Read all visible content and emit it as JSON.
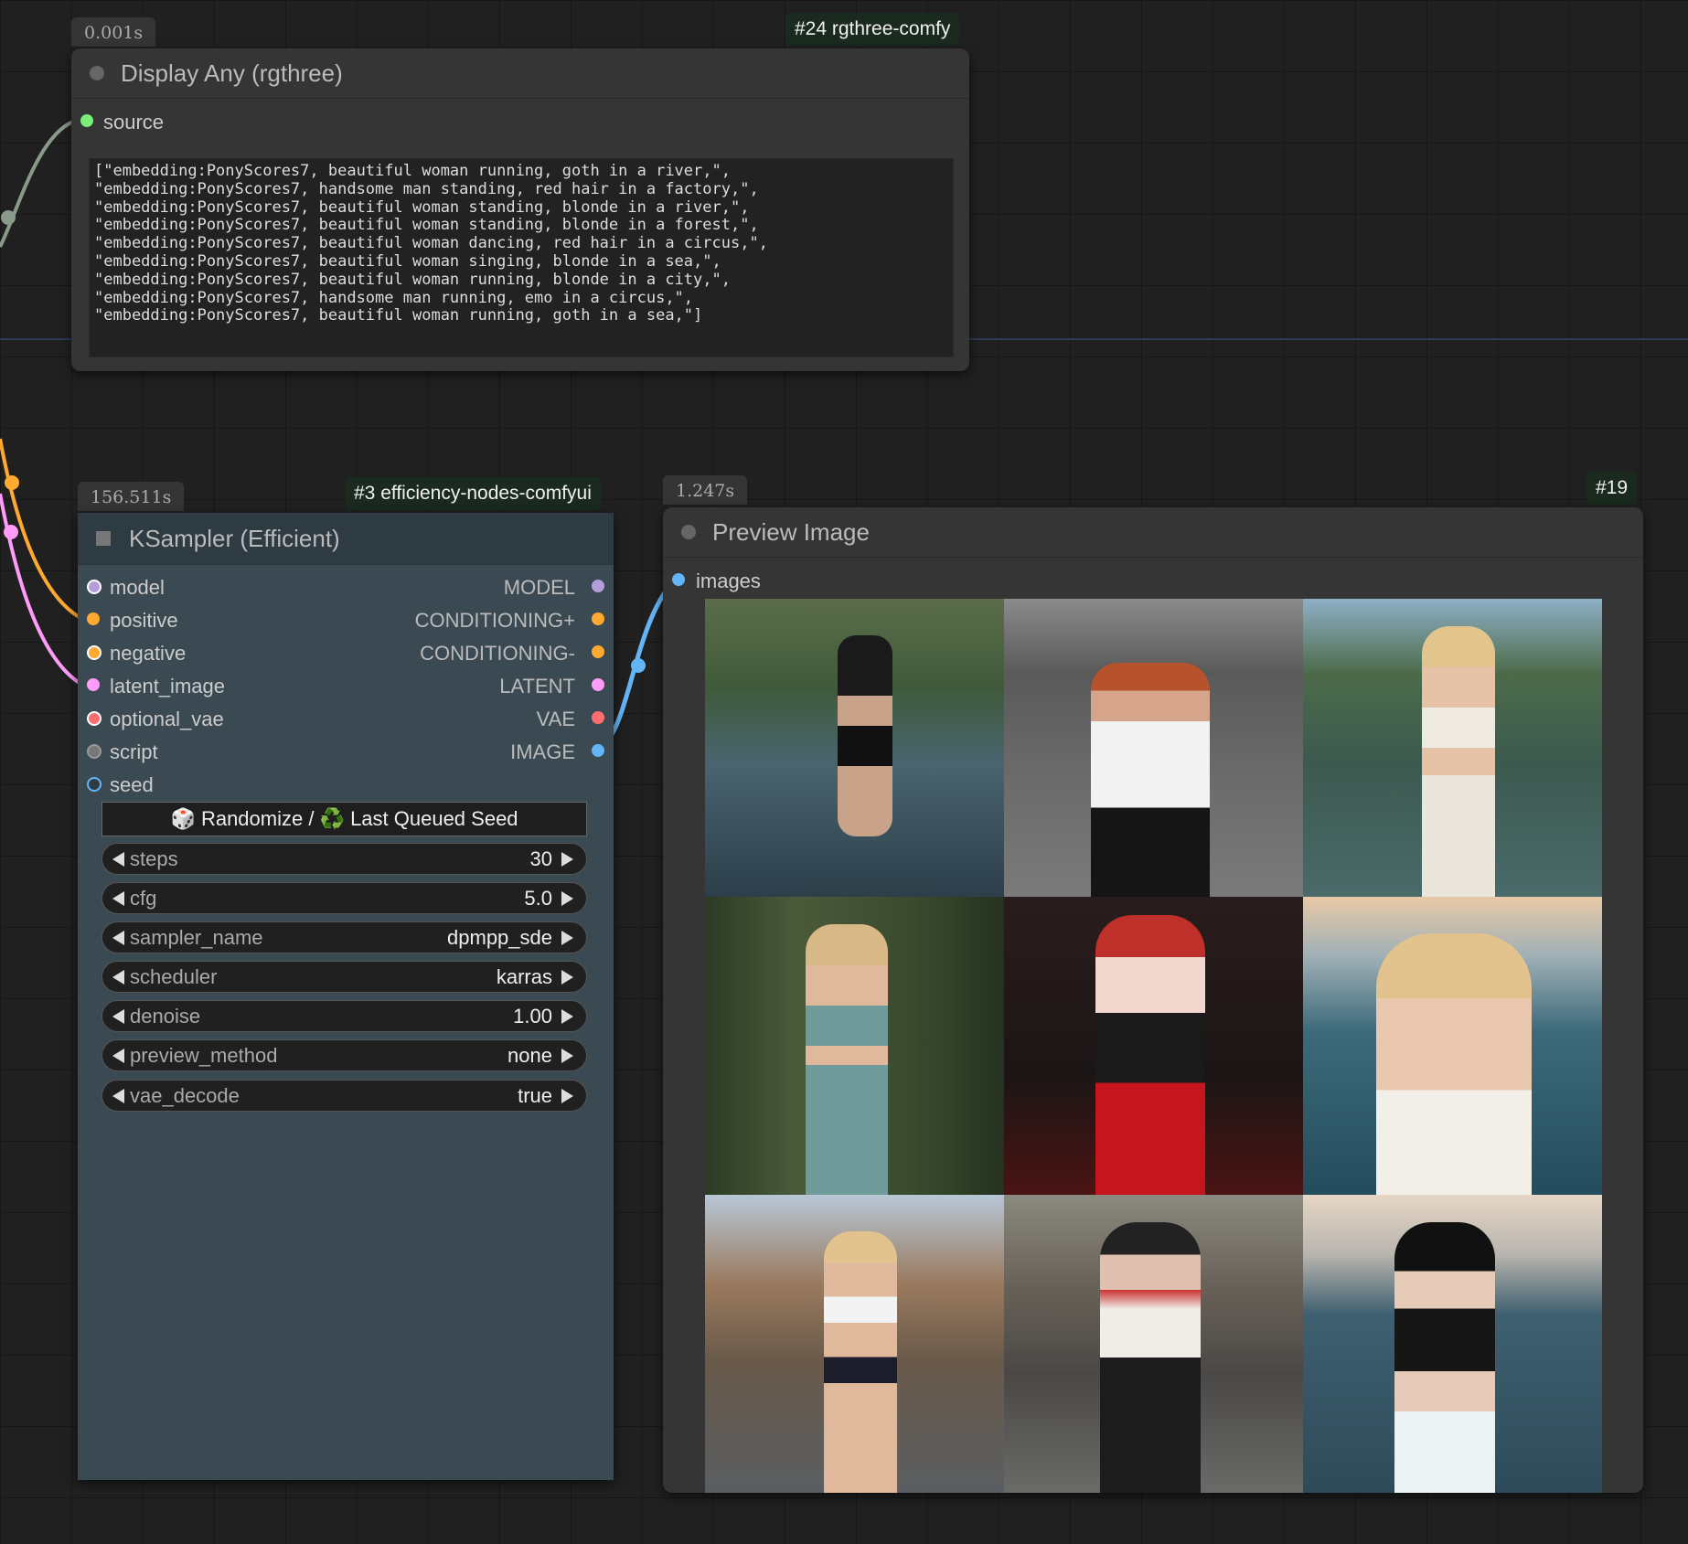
{
  "display_node": {
    "timer": "0.001s",
    "badge": "#24 rgthree-comfy",
    "title": "Display Any (rgthree)",
    "input_label": "source",
    "text": "[\"embedding:PonyScores7, beautiful woman running, goth in a river,\",\n\"embedding:PonyScores7, handsome man standing, red hair in a factory,\",\n\"embedding:PonyScores7, beautiful woman standing, blonde in a river,\",\n\"embedding:PonyScores7, beautiful woman standing, blonde in a forest,\",\n\"embedding:PonyScores7, beautiful woman dancing, red hair in a circus,\",\n\"embedding:PonyScores7, beautiful woman singing, blonde in a sea,\",\n\"embedding:PonyScores7, beautiful woman running, blonde in a city,\",\n\"embedding:PonyScores7, handsome man running, emo in a circus,\",\n\"embedding:PonyScores7, beautiful woman running, goth in a sea,\"]"
  },
  "ksampler_node": {
    "timer": "156.511s",
    "badge": "#3 efficiency-nodes-comfyui",
    "title": "KSampler (Efficient)",
    "inputs": [
      "model",
      "positive",
      "negative",
      "latent_image",
      "optional_vae",
      "script",
      "seed"
    ],
    "outputs": [
      "MODEL",
      "CONDITIONING+",
      "CONDITIONING-",
      "LATENT",
      "VAE",
      "IMAGE"
    ],
    "seed_button": "🎲 Randomize / ♻️ Last Queued Seed",
    "widgets": [
      {
        "name": "steps",
        "value": "30"
      },
      {
        "name": "cfg",
        "value": "5.0"
      },
      {
        "name": "sampler_name",
        "value": "dpmpp_sde"
      },
      {
        "name": "scheduler",
        "value": "karras"
      },
      {
        "name": "denoise",
        "value": "1.00"
      },
      {
        "name": "preview_method",
        "value": "none"
      },
      {
        "name": "vae_decode",
        "value": "true"
      }
    ]
  },
  "preview_node": {
    "timer": "1.247s",
    "badge": "#19",
    "title": "Preview Image",
    "input_label": "images"
  },
  "colors": {
    "model": "#b39ddb",
    "conditioning": "#ffa931",
    "latent": "#ff9cf9",
    "vae": "#ff6e6e",
    "image": "#64b5f6",
    "int": "#64b5f6",
    "string": "#77ee77",
    "script": "#888888"
  }
}
